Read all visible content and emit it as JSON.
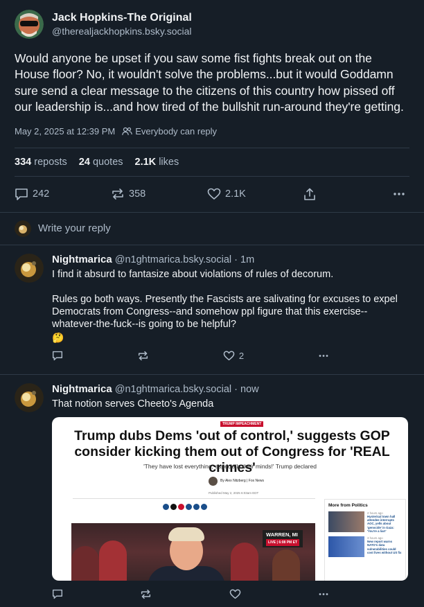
{
  "post": {
    "display_name": "Jack Hopkins-The Original",
    "handle": "@therealjackhopkins.bsky.social",
    "text": "Would anyone be upset if you saw some fist fights break out on the House floor? No, it wouldn't solve the problems...but it would Goddamn sure send a clear message to the citizens of this country how pissed off our leadership is...and how tired of the bullshit run-around they're getting.",
    "timestamp": "May 2, 2025 at 12:39 PM",
    "reply_setting": "Everybody can reply",
    "stats": {
      "reposts_count": "334",
      "reposts_label": "reposts",
      "quotes_count": "24",
      "quotes_label": "quotes",
      "likes_count": "2.1K",
      "likes_label": "likes"
    },
    "actions": {
      "replies": "242",
      "reposts": "358",
      "likes": "2.1K"
    }
  },
  "reply_box": {
    "placeholder": "Write your reply"
  },
  "replies": [
    {
      "display_name": "Nightmarica",
      "handle": "@n1ghtmarica.bsky.social",
      "time": "· 1m",
      "text": "I find it absurd to fantasize about violations of rules of decorum.\n\nRules go both ways.  Presently the Fascists are salivating for excuses to expel Democrats from Congress--and somehow ppl figure that this exercise--whatever-the-fuck--is going to be helpful?",
      "emoji": "🤔",
      "likes": "2"
    },
    {
      "display_name": "Nightmarica",
      "handle": "@n1ghtmarica.bsky.social",
      "time": "· now",
      "text": "That notion serves Cheeto's Agenda",
      "embed": {
        "badge": "TRUMP IMPEACHMENT",
        "headline": "Trump dubs Dems 'out of control,' suggests GOP consider kicking them out of Congress for 'REAL crimes'",
        "subhead": "'They have lost everything, especially their minds!' Trump declared",
        "byline": "By Alex Nitzberg  | Fox News",
        "published": "Published May 2, 2025 6:03am EDT",
        "video_location": "WARREN, MI",
        "video_live": "LIVE | 6:08 PM ET",
        "side_title": "More from Politics",
        "side_items": [
          {
            "ago": "2 hours ago",
            "text": "Hysterical town hall attendee interrupts AOC, yells about 'genocide' in Gaza: 'You're a liar!'"
          },
          {
            "ago": "3 hours ago",
            "text": "New report warns NATO's data vulnerabilities could cost lives without US fix"
          }
        ]
      }
    }
  ],
  "colors": {
    "background": "#161e27",
    "muted_text": "#aebbc9",
    "divider": "#2e3a47",
    "fox_red": "#c8102e"
  }
}
